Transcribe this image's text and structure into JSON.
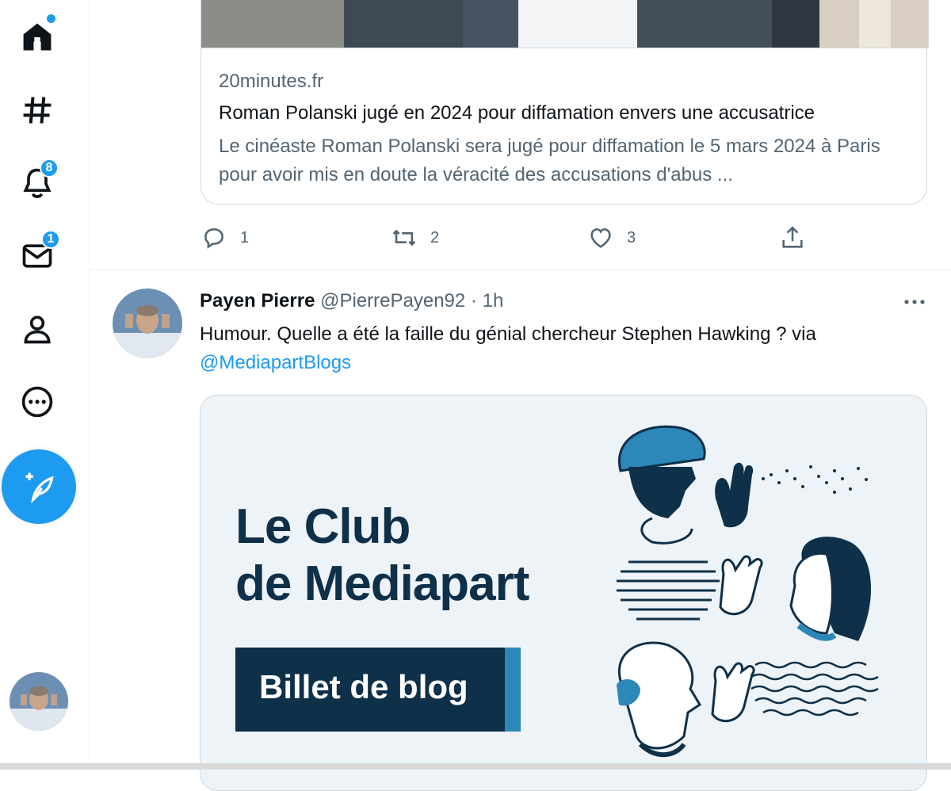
{
  "sidebar": {
    "items": [
      {
        "name": "home",
        "icon": "home-icon",
        "has_dot": true
      },
      {
        "name": "explore",
        "icon": "hashtag-icon"
      },
      {
        "name": "notifications",
        "icon": "bell-icon",
        "badge": "8"
      },
      {
        "name": "messages",
        "icon": "envelope-icon",
        "badge": "1"
      },
      {
        "name": "profile",
        "icon": "person-icon"
      },
      {
        "name": "more",
        "icon": "more-circle-icon"
      }
    ],
    "compose_icon": "compose-feather-icon"
  },
  "link_card": {
    "domain": "20minutes.fr",
    "title": "Roman Polanski jugé en 2024 pour diffamation envers une accusatrice",
    "description": "Le cinéaste Roman Polanski sera jugé pour diffamation le 5 mars 2024 à Paris pour avoir mis en doute la véracité des accusations d'abus ..."
  },
  "actions": {
    "replies": "1",
    "retweets": "2",
    "likes": "3"
  },
  "tweet": {
    "author": "Payen Pierre",
    "handle": "@PierrePayen92",
    "separator": "·",
    "time": "1h",
    "text": "Humour. Quelle a été la faille du génial chercheur Stephen Hawking ? via",
    "mention": "@MediapartBlogs",
    "media": {
      "title_line1": "Le Club",
      "title_line2": "de Mediapart",
      "button_label": "Billet de blog"
    }
  },
  "colors": {
    "accent": "#1d9bf0",
    "text_primary": "#0f1419",
    "text_secondary": "#536471",
    "mediapart_navy": "#0e3049",
    "mediapart_blue": "#2d87b8"
  }
}
